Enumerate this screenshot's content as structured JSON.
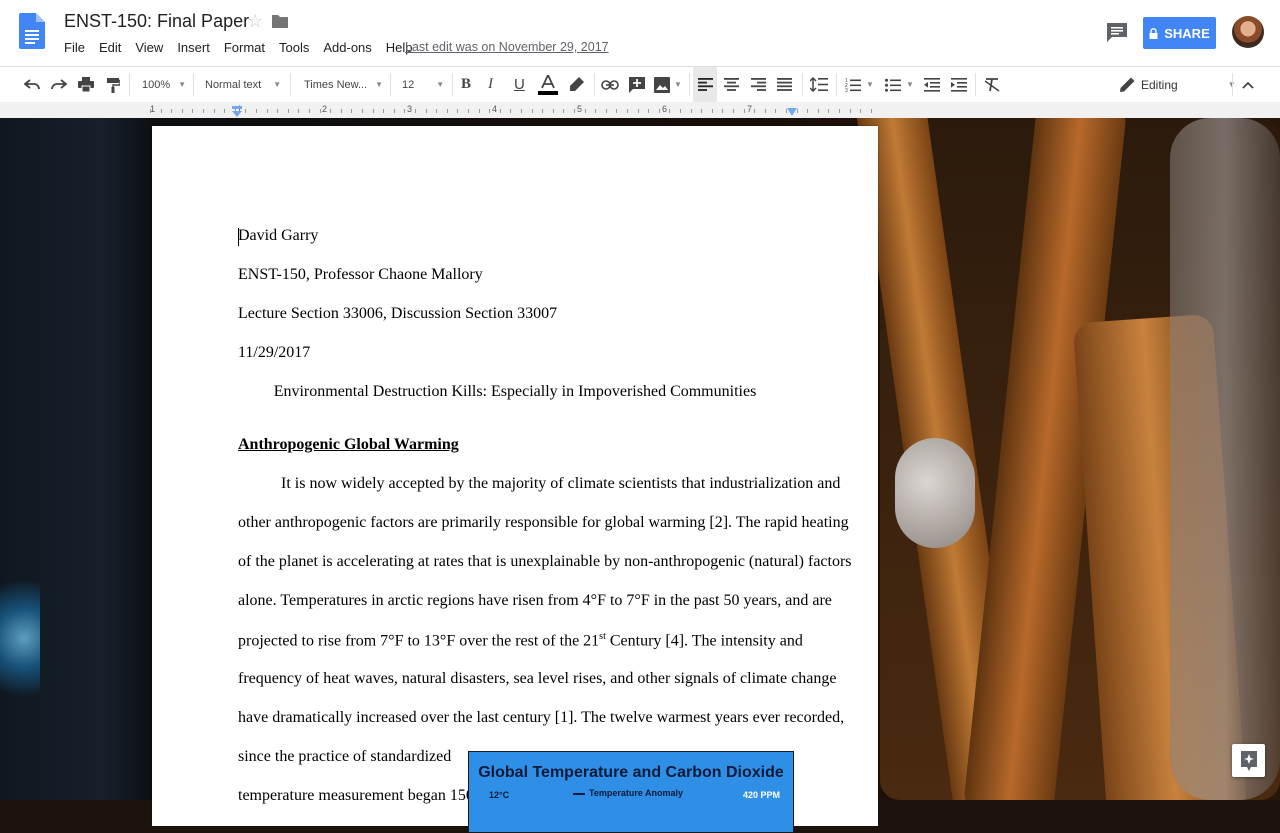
{
  "doc": {
    "title": "ENST-150: Final Paper",
    "last_edit": "Last edit was on November 29, 2017"
  },
  "menu": [
    "File",
    "Edit",
    "View",
    "Insert",
    "Format",
    "Tools",
    "Add-ons",
    "Help"
  ],
  "share": {
    "label": "SHARE"
  },
  "toolbar": {
    "zoom": "100%",
    "style": "Normal text",
    "font": "Times New...",
    "size": "12",
    "mode": "Editing"
  },
  "ruler": {
    "numbers": [
      "1",
      "1",
      "2",
      "3",
      "4",
      "5",
      "6",
      "7"
    ]
  },
  "content": {
    "lines": [
      "David Garry",
      "ENST-150, Professor Chaone Mallory",
      "Lecture Section 33006, Discussion Section 33007",
      "11/29/2017"
    ],
    "title": "Environmental Destruction Kills: Especially in Impoverished Communities",
    "heading": "Anthropogenic Global Warming",
    "paragraph": [
      "It is now widely accepted by the majority of climate scientists that industrialization and",
      "other anthropogenic factors are primarily responsible for global warming [2]. The rapid heating",
      "of the planet is accelerating at rates that is unexplainable by non-anthropogenic (natural) factors",
      "alone. Temperatures in arctic regions have risen from 4°F to 7°F in the past 50 years, and are",
      "projected to rise from 7°F to 13°F over the rest of the 21",
      "st",
      " Century [4]. The intensity and",
      "frequency of heat waves, natural disasters, sea level rises, and other signals of climate change",
      "have dramatically increased over the last century [1]. The twelve warmest years ever recorded,",
      "since the practice of standardized",
      "temperature measurement began 150"
    ]
  },
  "chart": {
    "title": "Global Temperature and Carbon Dioxide",
    "legend": "Temperature Anomaly",
    "y_left_top": "12°C",
    "y_right_top": "420 PPM",
    "bg_color": "#2f8fe6"
  },
  "colors": {
    "accent": "#4285f4",
    "doc_blue": "#4285f4"
  }
}
